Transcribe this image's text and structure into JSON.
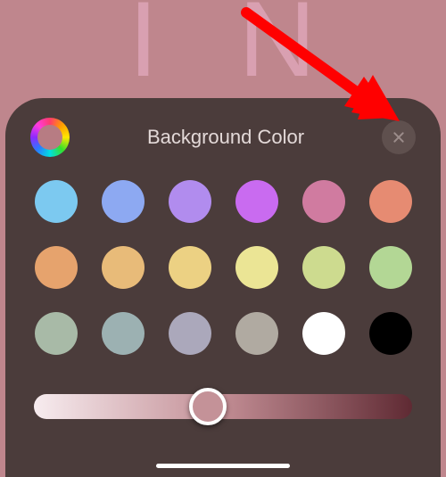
{
  "bg_letters": [
    "I",
    "N"
  ],
  "title": "Background Color",
  "spectrum_inner": "#b77c83",
  "close_icon": "close-icon",
  "swatches": [
    "#7cc9f0",
    "#8da9f2",
    "#b18cee",
    "#c96bf0",
    "#d07ba0",
    "#e68b72",
    "#e6a36d",
    "#e8bb79",
    "#ecd183",
    "#ebe595",
    "#cddb8f",
    "#b3d795",
    "#a8baa7",
    "#9cb1b2",
    "#aba8bb",
    "#b0aaa1",
    "#ffffff",
    "#000000"
  ],
  "slider": {
    "gradient_from": "#f7ecef",
    "gradient_mid": "#c28d94",
    "gradient_to": "#5f2a33",
    "value": 0.46,
    "thumb_color": "#c49298"
  }
}
